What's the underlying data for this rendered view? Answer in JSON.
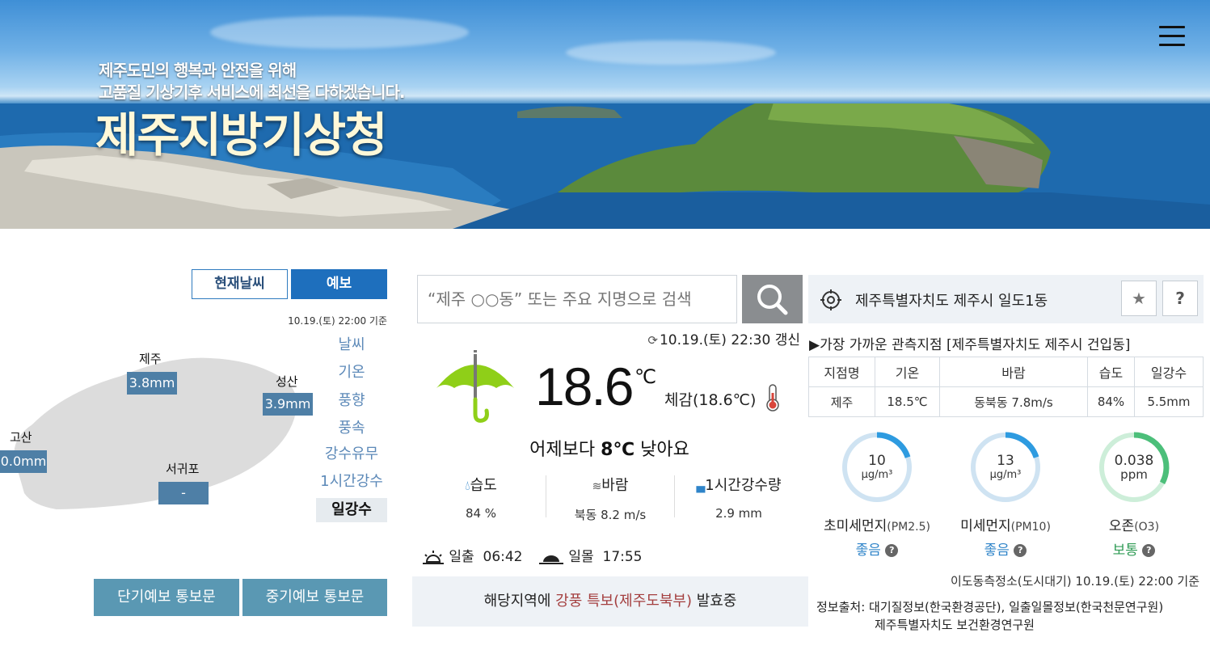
{
  "header": {
    "slogan_line1": "제주도민의 행복과 안전을 위해",
    "slogan_line2": "고품질 기상기후 서비스에 최선을 다하겠습니다.",
    "title": "제주지방기상청",
    "menu_icon": "hamburger-menu-icon"
  },
  "left": {
    "tabs": {
      "now": "현재날씨",
      "forecast": "예보"
    },
    "base_time": "10.19.(토) 22:00 기준",
    "cities": [
      {
        "name": "제주",
        "value": "3.8mm"
      },
      {
        "name": "성산",
        "value": "3.9mm"
      },
      {
        "name": "고산",
        "value": "0.0mm"
      },
      {
        "name": "서귀포",
        "value": "-"
      }
    ],
    "menu": [
      "날씨",
      "기온",
      "풍향",
      "풍속",
      "강수유무",
      "1시간강수",
      "일강수"
    ],
    "menu_active": "일강수",
    "buttons": {
      "short": "단기예보 통보문",
      "mid": "중기예보 통보문"
    }
  },
  "middle": {
    "search_placeholder": "“제주 ○○동” 또는 주요 지명으로 검색",
    "update_time": "10.19.(토) 22:30 갱신",
    "weather_icon": "umbrella-icon",
    "temperature": "18.6",
    "temp_unit": "℃",
    "feels_like": "체감(18.6℃)",
    "compare_prefix": "어제보다 ",
    "compare_value": "8℃",
    "compare_suffix": " 낮아요",
    "stats": {
      "humidity_label": "습도",
      "humidity_value": "84 %",
      "wind_label": "바람",
      "wind_value": "북동 8.2 m/s",
      "rain_label": "1시간강수량",
      "rain_value": "2.9 mm"
    },
    "sunrise_label": "일출",
    "sunrise_time": "06:42",
    "sunset_label": "일몰",
    "sunset_time": "17:55",
    "alert_prefix": "해당지역에 ",
    "alert_highlight": "강풍 특보(제주도북부)",
    "alert_suffix": " 발효중"
  },
  "right": {
    "location": "제주특별자치도 제주시 일도1동",
    "star_label": "★",
    "help_label": "?",
    "nearest": "▶가장 가까운 관측지점 [제주특별자치도 제주시 건입동]",
    "table": {
      "headers": [
        "지점명",
        "기온",
        "바람",
        "습도",
        "일강수"
      ],
      "row": [
        "제주",
        "18.5℃",
        "동북동 7.8m/s",
        "84%",
        "5.5mm"
      ]
    },
    "air": [
      {
        "value": "10",
        "unit": "μg/m³",
        "name": "초미세먼지",
        "sub": "(PM2.5)",
        "grade": "좋음",
        "level": 0.2,
        "color": "#2e9be0",
        "track": "#cfe3f2",
        "grade_color": "#2f84c9"
      },
      {
        "value": "13",
        "unit": "μg/m³",
        "name": "미세먼지",
        "sub": "(PM10)",
        "grade": "좋음",
        "level": 0.2,
        "color": "#2e9be0",
        "track": "#cfe3f2",
        "grade_color": "#2f84c9"
      },
      {
        "value": "0.038",
        "unit": "ppm",
        "name": "오존",
        "sub": "(O3)",
        "grade": "보통",
        "level": 0.33,
        "color": "#4cbf7a",
        "track": "#cdeed9",
        "grade_color": "#2f9b55"
      }
    ],
    "station_time": "이도동측정소(도시대기) 10.19.(토) 22:00 기준",
    "source_line1": "정보출처: 대기질정보(한국환경공단), 일출일몰정보(한국천문연구원)",
    "source_line2": "제주특별자치도 보건환경연구원"
  }
}
